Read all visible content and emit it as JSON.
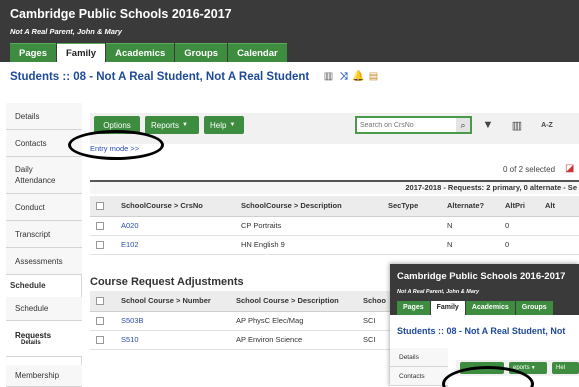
{
  "app": {
    "title": "Cambridge Public Schools 2016-2017",
    "user": "Not A Real Parent, John & Mary"
  },
  "nav": {
    "tabs": [
      {
        "label": "Pages",
        "active": false
      },
      {
        "label": "Family",
        "active": true
      },
      {
        "label": "Academics",
        "active": false
      },
      {
        "label": "Groups",
        "active": false
      },
      {
        "label": "Calendar",
        "active": false
      }
    ]
  },
  "page": {
    "heading": "Students :: 08 - Not A Real Student, Not A Real Student",
    "title_icons": [
      "report-icon",
      "shuffle-icon",
      "alert-bell-icon",
      "vcard-icon"
    ]
  },
  "sidebar": {
    "items": [
      {
        "label": "Details"
      },
      {
        "label": "Contacts"
      },
      {
        "label": "Daily Attendance"
      },
      {
        "label": "Conduct"
      },
      {
        "label": "Transcript"
      },
      {
        "label": "Assessments"
      }
    ],
    "schedule_header": "Schedule",
    "sub_items": [
      {
        "label": "Schedule",
        "sub": ""
      },
      {
        "label": "Requests",
        "sub": "Details"
      }
    ],
    "membership": "Membership"
  },
  "toolbar": {
    "options_label": "Options",
    "reports_label": "Reports",
    "help_label": "Help",
    "search_placeholder": "Search on CrsNo",
    "filter_icon": "filter-icon",
    "columns_icon": "columns-icon",
    "sort_icon": "sort-az-icon",
    "sort_label": "A-Z"
  },
  "entry_mode": "Entry mode >>",
  "selection": {
    "text": "0 of 2 selected"
  },
  "requests_summary": "2017-2018 - Requests: 2 primary, 0 alternate - Se",
  "requests_table": {
    "columns": [
      "SchoolCourse > CrsNo",
      "SchoolCourse > Description",
      "SecType",
      "Alternate?",
      "AltPri",
      "Alt"
    ],
    "rows": [
      [
        "A020",
        "CP Portraits",
        "",
        "N",
        "0",
        ""
      ],
      [
        "E102",
        "HN English 9",
        "",
        "N",
        "0",
        ""
      ]
    ]
  },
  "adjustments": {
    "heading": "Course Request Adjustments",
    "columns": [
      "School Course > Number",
      "School Course > Description",
      "Schoo"
    ],
    "rows": [
      [
        "S503B",
        "AP PhysC Elec/Mag",
        "SCI"
      ],
      [
        "S510",
        "AP Environ Science",
        "SCI"
      ]
    ]
  },
  "overlay": {
    "title": "Cambridge Public Schools 2016-2017",
    "user": "Not A Real Parent, John & Mary",
    "tabs": [
      {
        "label": "Pages",
        "active": false
      },
      {
        "label": "Family",
        "active": true
      },
      {
        "label": "Academics",
        "active": false
      },
      {
        "label": "Groups",
        "active": false
      }
    ],
    "heading": "Students :: 08 - Not A Real Student, Not",
    "sidebar": [
      {
        "label": "Details"
      },
      {
        "label": "Contacts"
      }
    ],
    "reports_label": "eports",
    "help_label": "Hel"
  }
}
